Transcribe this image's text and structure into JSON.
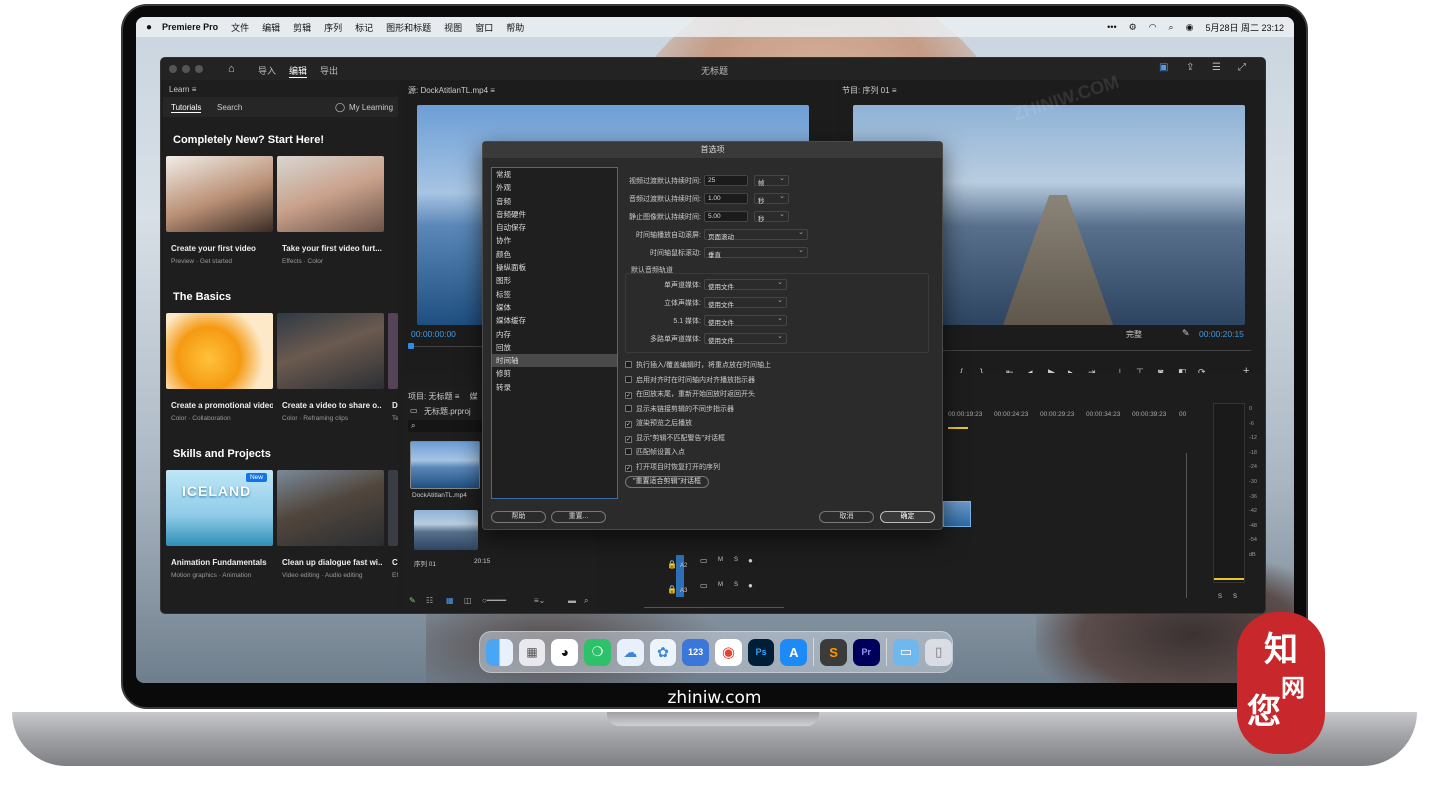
{
  "menubar": {
    "app": "Premiere Pro",
    "items": [
      "文件",
      "编辑",
      "剪辑",
      "序列",
      "标记",
      "图形和标题",
      "视图",
      "窗口",
      "帮助"
    ],
    "clock": "5月28日 周二  23:12",
    "dots": "•••"
  },
  "titlebar": {
    "tabs": [
      "导入",
      "编辑",
      "导出"
    ],
    "active": "编辑",
    "title": "无标题"
  },
  "learn": {
    "header": "Learn",
    "tabs": [
      "Tutorials",
      "Search"
    ],
    "account": "My Learning",
    "sections": [
      {
        "title": "Completely New? Start Here!",
        "cards": [
          {
            "title": "Create your first video",
            "sub": "Preview  ·  Get started"
          },
          {
            "title": "Take your first video furt...",
            "sub": "Effects  ·  Color"
          }
        ]
      },
      {
        "title": "The Basics",
        "cards": [
          {
            "title": "Create a promotional video",
            "sub": "Color  ·  Collaboration"
          },
          {
            "title": "Create a video to share o...",
            "sub": "Color  ·  Reframing clips"
          },
          {
            "title": "D",
            "sub": "Te"
          }
        ]
      },
      {
        "title": "Skills and Projects",
        "cards": [
          {
            "title": "Animation Fundamentals",
            "sub": "Motion graphics  ·  Animation",
            "badge": "New",
            "thumbtext": "ICELAND"
          },
          {
            "title": "Clean up dialogue fast wi...",
            "sub": "Video editing  ·  Audio editing"
          },
          {
            "title": "C",
            "sub": "Ef"
          }
        ]
      }
    ]
  },
  "source": {
    "header": "源: DockAtitlanTL.mp4",
    "timecode": "00:00:00:00"
  },
  "program": {
    "header": "节目: 序列 01",
    "timecode": "00:00:20:15",
    "quality": "完整"
  },
  "project": {
    "header": "项目: 无标题",
    "tab2": "媒",
    "file": "无标题.prproj",
    "search_placeholder": "",
    "items": [
      {
        "name": "DockAtitlanTL.mp4"
      },
      {
        "name": "序列 01",
        "dur": "20:15"
      }
    ]
  },
  "timeline": {
    "ruler": [
      "00:00:19:23",
      "00:00:24:23",
      "00:00:29:23",
      "00:00:34:23",
      "00:00:39:23",
      "00"
    ],
    "tracks": [
      "A2",
      "A3"
    ],
    "track_btns": [
      "M",
      "S"
    ]
  },
  "meter": {
    "scale": [
      "0",
      "-6",
      "-12",
      "-18",
      "-24",
      "-30",
      "-36",
      "-42",
      "-48",
      "-54",
      "dB"
    ],
    "solo": [
      "S",
      "S"
    ]
  },
  "dialog": {
    "title": "首选项",
    "categories": [
      "常规",
      "外观",
      "音频",
      "音频硬件",
      "自动保存",
      "协作",
      "颜色",
      "操纵面板",
      "图形",
      "标签",
      "媒体",
      "媒体缓存",
      "内存",
      "回放",
      "时间轴",
      "修剪",
      "转录"
    ],
    "selected": "时间轴",
    "rows": [
      {
        "label": "视频过渡默认持续时间:",
        "value": "25",
        "unit": "帧"
      },
      {
        "label": "音频过渡默认持续时间:",
        "value": "1.00",
        "unit": "秒"
      },
      {
        "label": "静止图像默认持续时间:",
        "value": "5.00",
        "unit": "秒"
      }
    ],
    "scroll": {
      "label": "时间轴播放自动滚屏:",
      "value": "页面滚动"
    },
    "wheel": {
      "label": "时间轴鼠标滚动:",
      "value": "垂直"
    },
    "audio_section": "默认音频轨道",
    "audio": [
      {
        "label": "单声道媒体:",
        "value": "使用文件"
      },
      {
        "label": "立体声媒体:",
        "value": "使用文件"
      },
      {
        "label": "5.1 媒体:",
        "value": "使用文件"
      },
      {
        "label": "多路单声道媒体:",
        "value": "使用文件"
      }
    ],
    "checks": [
      {
        "label": "执行插入/覆盖编辑时，将重点放在时间轴上",
        "checked": false
      },
      {
        "label": "启用对齐时在时间轴内对齐播放指示器",
        "checked": false
      },
      {
        "label": "在回放末尾，重新开始回放时返回开头",
        "checked": true
      },
      {
        "label": "显示未链接剪辑的不同步指示器",
        "checked": false
      },
      {
        "label": "渲染预览之后播放",
        "checked": true
      },
      {
        "label": "显示\"剪辑不匹配警告\"对话框",
        "checked": true
      },
      {
        "label": "匹配帧设置入点",
        "checked": false
      },
      {
        "label": "打开项目时恢复打开的序列",
        "checked": true
      }
    ],
    "reset_button": "\"重置适合剪辑\"对话框",
    "help": "帮助",
    "redo": "重置...",
    "cancel": "取消",
    "ok": "确定"
  },
  "dock": {
    "icons": [
      "finder-icon",
      "launchpad-icon",
      "qq-icon",
      "wechat-icon",
      "cloud-icon",
      "flower-icon",
      "123",
      "chrome-icon",
      "Ps",
      "appstore-icon",
      "sublime-icon",
      "Pr",
      "folder-icon",
      "trash-icon"
    ],
    "labels": {
      "numbers": "123",
      "ps": "Ps",
      "pr": "Pr"
    }
  },
  "brand": "zhiniw.com",
  "seal": {
    "line1": "知",
    "line2": "您",
    "line3": "网"
  },
  "colors": {
    "accent": "#2d8ceb",
    "timecode": "#3d9be9",
    "seal": "#c8282c"
  }
}
